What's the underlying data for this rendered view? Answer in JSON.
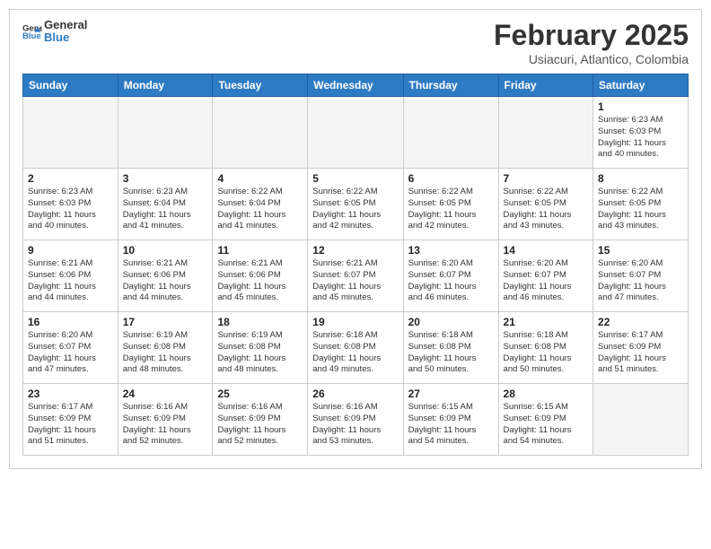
{
  "logo": {
    "line1": "General",
    "line2": "Blue"
  },
  "title": "February 2025",
  "location": "Usiacuri, Atlantico, Colombia",
  "weekdays": [
    "Sunday",
    "Monday",
    "Tuesday",
    "Wednesday",
    "Thursday",
    "Friday",
    "Saturday"
  ],
  "weeks": [
    [
      {
        "day": "",
        "info": ""
      },
      {
        "day": "",
        "info": ""
      },
      {
        "day": "",
        "info": ""
      },
      {
        "day": "",
        "info": ""
      },
      {
        "day": "",
        "info": ""
      },
      {
        "day": "",
        "info": ""
      },
      {
        "day": "1",
        "info": "Sunrise: 6:23 AM\nSunset: 6:03 PM\nDaylight: 11 hours\nand 40 minutes."
      }
    ],
    [
      {
        "day": "2",
        "info": "Sunrise: 6:23 AM\nSunset: 6:03 PM\nDaylight: 11 hours\nand 40 minutes."
      },
      {
        "day": "3",
        "info": "Sunrise: 6:23 AM\nSunset: 6:04 PM\nDaylight: 11 hours\nand 41 minutes."
      },
      {
        "day": "4",
        "info": "Sunrise: 6:22 AM\nSunset: 6:04 PM\nDaylight: 11 hours\nand 41 minutes."
      },
      {
        "day": "5",
        "info": "Sunrise: 6:22 AM\nSunset: 6:05 PM\nDaylight: 11 hours\nand 42 minutes."
      },
      {
        "day": "6",
        "info": "Sunrise: 6:22 AM\nSunset: 6:05 PM\nDaylight: 11 hours\nand 42 minutes."
      },
      {
        "day": "7",
        "info": "Sunrise: 6:22 AM\nSunset: 6:05 PM\nDaylight: 11 hours\nand 43 minutes."
      },
      {
        "day": "8",
        "info": "Sunrise: 6:22 AM\nSunset: 6:05 PM\nDaylight: 11 hours\nand 43 minutes."
      }
    ],
    [
      {
        "day": "9",
        "info": "Sunrise: 6:21 AM\nSunset: 6:06 PM\nDaylight: 11 hours\nand 44 minutes."
      },
      {
        "day": "10",
        "info": "Sunrise: 6:21 AM\nSunset: 6:06 PM\nDaylight: 11 hours\nand 44 minutes."
      },
      {
        "day": "11",
        "info": "Sunrise: 6:21 AM\nSunset: 6:06 PM\nDaylight: 11 hours\nand 45 minutes."
      },
      {
        "day": "12",
        "info": "Sunrise: 6:21 AM\nSunset: 6:07 PM\nDaylight: 11 hours\nand 45 minutes."
      },
      {
        "day": "13",
        "info": "Sunrise: 6:20 AM\nSunset: 6:07 PM\nDaylight: 11 hours\nand 46 minutes."
      },
      {
        "day": "14",
        "info": "Sunrise: 6:20 AM\nSunset: 6:07 PM\nDaylight: 11 hours\nand 46 minutes."
      },
      {
        "day": "15",
        "info": "Sunrise: 6:20 AM\nSunset: 6:07 PM\nDaylight: 11 hours\nand 47 minutes."
      }
    ],
    [
      {
        "day": "16",
        "info": "Sunrise: 6:20 AM\nSunset: 6:07 PM\nDaylight: 11 hours\nand 47 minutes."
      },
      {
        "day": "17",
        "info": "Sunrise: 6:19 AM\nSunset: 6:08 PM\nDaylight: 11 hours\nand 48 minutes."
      },
      {
        "day": "18",
        "info": "Sunrise: 6:19 AM\nSunset: 6:08 PM\nDaylight: 11 hours\nand 48 minutes."
      },
      {
        "day": "19",
        "info": "Sunrise: 6:18 AM\nSunset: 6:08 PM\nDaylight: 11 hours\nand 49 minutes."
      },
      {
        "day": "20",
        "info": "Sunrise: 6:18 AM\nSunset: 6:08 PM\nDaylight: 11 hours\nand 50 minutes."
      },
      {
        "day": "21",
        "info": "Sunrise: 6:18 AM\nSunset: 6:08 PM\nDaylight: 11 hours\nand 50 minutes."
      },
      {
        "day": "22",
        "info": "Sunrise: 6:17 AM\nSunset: 6:09 PM\nDaylight: 11 hours\nand 51 minutes."
      }
    ],
    [
      {
        "day": "23",
        "info": "Sunrise: 6:17 AM\nSunset: 6:09 PM\nDaylight: 11 hours\nand 51 minutes."
      },
      {
        "day": "24",
        "info": "Sunrise: 6:16 AM\nSunset: 6:09 PM\nDaylight: 11 hours\nand 52 minutes."
      },
      {
        "day": "25",
        "info": "Sunrise: 6:16 AM\nSunset: 6:09 PM\nDaylight: 11 hours\nand 52 minutes."
      },
      {
        "day": "26",
        "info": "Sunrise: 6:16 AM\nSunset: 6:09 PM\nDaylight: 11 hours\nand 53 minutes."
      },
      {
        "day": "27",
        "info": "Sunrise: 6:15 AM\nSunset: 6:09 PM\nDaylight: 11 hours\nand 54 minutes."
      },
      {
        "day": "28",
        "info": "Sunrise: 6:15 AM\nSunset: 6:09 PM\nDaylight: 11 hours\nand 54 minutes."
      },
      {
        "day": "",
        "info": ""
      }
    ]
  ]
}
